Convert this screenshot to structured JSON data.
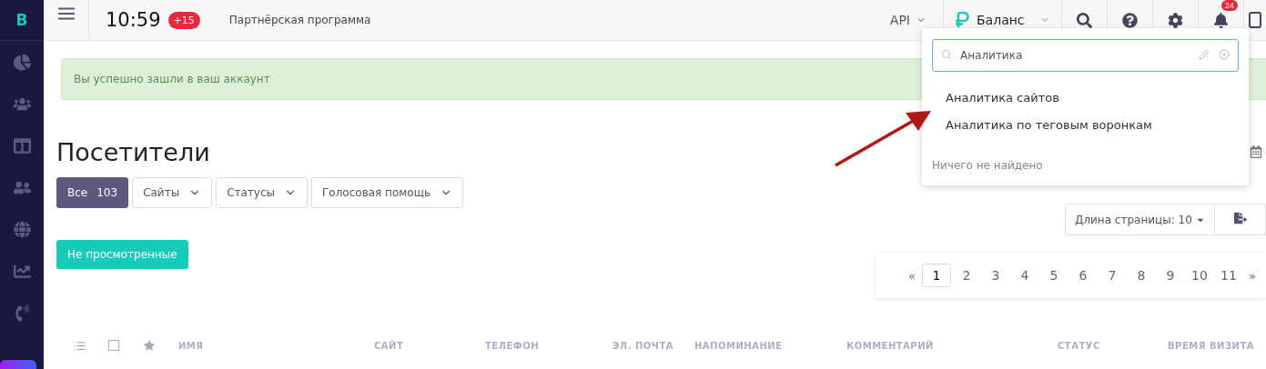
{
  "sidebar": {
    "logo": "B"
  },
  "topbar": {
    "time": "10:59",
    "time_badge": "+15",
    "partner_link": "Партнёрская программа",
    "api": "API",
    "balance": "Баланс",
    "notifications_badge": "24"
  },
  "alert": "Вы успешно зашли в ваш аккаунт",
  "title": "Посетители",
  "filters": [
    {
      "label": "Все",
      "count": "103",
      "selected": true
    },
    {
      "label": "Сайты",
      "selected": false
    },
    {
      "label": "Статусы",
      "selected": false
    },
    {
      "label": "Голосовая помощь",
      "selected": false
    }
  ],
  "unviewed_button": "Не просмотренные",
  "page_length": "Длина страницы: 10",
  "pagination": {
    "prev": "«",
    "next": "»",
    "pages": [
      {
        "label": "1",
        "selected": true
      },
      {
        "label": "2",
        "selected": false
      },
      {
        "label": "3",
        "selected": false
      },
      {
        "label": "4",
        "selected": false
      },
      {
        "label": "5",
        "selected": false
      },
      {
        "label": "6",
        "selected": false
      },
      {
        "label": "7",
        "selected": false
      },
      {
        "label": "8",
        "selected": false
      },
      {
        "label": "9",
        "selected": false
      },
      {
        "label": "10",
        "selected": false
      },
      {
        "label": "11",
        "selected": false
      }
    ]
  },
  "table": {
    "select_all_checked": false,
    "columns": [
      "ИМЯ",
      "САЙТ",
      "ТЕЛЕФОН",
      "ЭЛ. ПОЧТА",
      "НАПОМИНАНИЕ",
      "КОММЕНТАРИЙ",
      "СТАТУС",
      "ВРЕМЯ ВИЗИТА"
    ]
  },
  "search_dropdown": {
    "value": "Аналитика",
    "results": [
      "Аналитика сайтов",
      "Аналитика по теговым воронкам"
    ],
    "empty_message": "Ничего не найдено"
  }
}
